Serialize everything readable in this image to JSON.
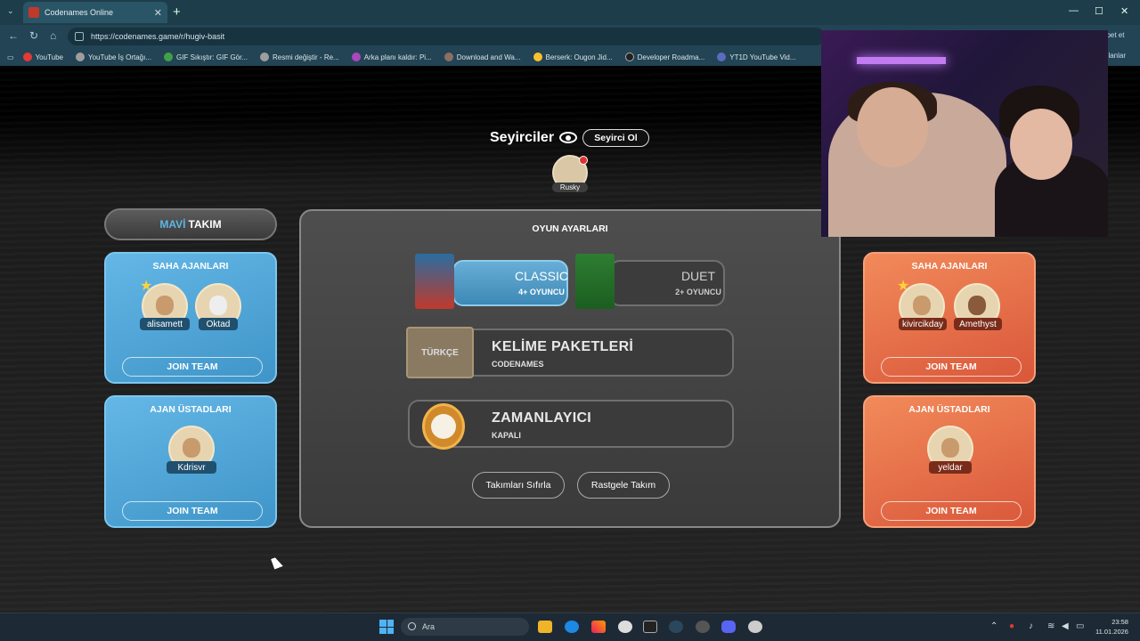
{
  "browser": {
    "tab_title": "Codenames Online",
    "url": "https://codenames.game/r/hugiv-basit",
    "bookmarks": [
      {
        "label": "YouTube",
        "color": "#e53935"
      },
      {
        "label": "YouTube İş Ortağı...",
        "color": "#9e9e9e"
      },
      {
        "label": "GIF Sıkıştır: GIF Gör...",
        "color": "#43a047"
      },
      {
        "label": "Resmi değiştir - Re...",
        "color": "#9e9e9e"
      },
      {
        "label": "Arka planı kaldır: Pi...",
        "color": "#ab47bc"
      },
      {
        "label": "Download and Wa...",
        "color": "#8d6e63"
      },
      {
        "label": "Berserk: Ougon Jid...",
        "color": "#fbc02d"
      },
      {
        "label": "Developer Roadma...",
        "color": "#212121"
      },
      {
        "label": "YT1D YouTube Vid...",
        "color": "#5c6bc0"
      }
    ],
    "chat_label": "hbet et",
    "bookmarks_more": "nlanlar"
  },
  "spectators": {
    "title": "Seyirciler",
    "button": "Seyirci Ol",
    "players": [
      "Rusky"
    ]
  },
  "blue_team": {
    "header_color_word": "MAVİ",
    "header_word": "TAKIM",
    "field_title": "SAHA AJANLARI",
    "field_agents": [
      "alisamett",
      "Oktad"
    ],
    "spymaster_title": "AJAN ÜSTADLARI",
    "spymasters": [
      "Kdrisvr"
    ],
    "join_label": "JOIN TEAM"
  },
  "red_team": {
    "field_title": "SAHA AJANLARI",
    "field_agents": [
      "kivircikday",
      "Amethyst"
    ],
    "spymaster_title": "AJAN ÜSTADLARI",
    "spymasters": [
      "yeldar"
    ],
    "join_label": "JOIN TEAM"
  },
  "settings": {
    "title": "OYUN AYARLARI",
    "mode_classic": {
      "label": "CLASSIC",
      "sub": "4+ OYUNCU",
      "selected": true
    },
    "mode_duet": {
      "label": "DUET",
      "sub": "2+ OYUNCU",
      "selected": false
    },
    "word_packs": {
      "label": "KELİME PAKETLERİ",
      "sub": "CODENAMES",
      "badge": "TÜRKÇE"
    },
    "timer": {
      "label": "ZAMANLAYICI",
      "sub": "KAPALI"
    },
    "reset_teams": "Takımları Sıfırla",
    "random_teams": "Rastgele Takım"
  },
  "taskbar": {
    "search_placeholder": "Ara",
    "time": "23:58",
    "date": "11.01.2026"
  },
  "colors": {
    "blue_card": "#4fa6d8",
    "red_card": "#e8714a",
    "accent_blue": "#5fb6e6"
  }
}
